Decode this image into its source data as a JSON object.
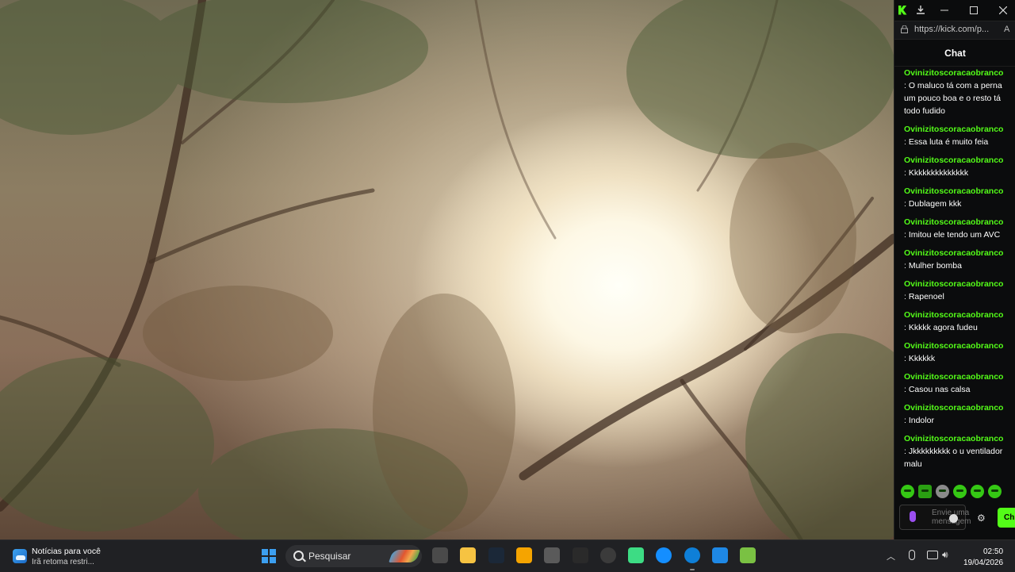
{
  "chat_window": {
    "title_icons": [
      "kick-logo-icon",
      "download-icon",
      "minimize-icon",
      "maximize-icon",
      "close-icon"
    ],
    "url": "https://kick.com/p...",
    "header": "Chat",
    "accent_color": "#53fc18",
    "messages": [
      {
        "user": "Ovinizitoscoracaobranco",
        "text": ": O maluco tá com a perna um pouco boa e o resto tá todo fudido"
      },
      {
        "user": "Ovinizitoscoracaobranco",
        "text": ": Essa luta é muito feia"
      },
      {
        "user": "Ovinizitoscoracaobranco",
        "text": ": Kkkkkkkkkkkkkk"
      },
      {
        "user": "Ovinizitoscoracaobranco",
        "text": ": Dublagem kkk"
      },
      {
        "user": "Ovinizitoscoracaobranco",
        "text": ": Imitou ele tendo um AVC"
      },
      {
        "user": "Ovinizitoscoracaobranco",
        "text": ": Mulher bomba"
      },
      {
        "user": "Ovinizitoscoracaobranco",
        "text": ": Rapenoel"
      },
      {
        "user": "Ovinizitoscoracaobranco",
        "text": ": Kkkkk agora fudeu"
      },
      {
        "user": "Ovinizitoscoracaobranco",
        "text": ": Kkkkkk"
      },
      {
        "user": "Ovinizitoscoracaobranco",
        "text": ": Casou nas calsa"
      },
      {
        "user": "Ovinizitoscoracaobranco",
        "text": ": Indolor"
      },
      {
        "user": "Ovinizitoscoracaobranco",
        "text": ": Jkkkkkkkkk o u ventilador malu"
      }
    ],
    "input": {
      "placeholder": "Envie uma mensagem"
    },
    "send_label": "Ch"
  },
  "taskbar": {
    "news": {
      "title": "Notícias para você",
      "subtitle": "Irã retoma restri..."
    },
    "search_placeholder": "Pesquisar",
    "apps": [
      "task-view",
      "file-explorer",
      "steam",
      "rockstar-launcher",
      "settings-gear",
      "epic-games",
      "obs-studio",
      "android-studio",
      "battle-net",
      "edge",
      "notepad",
      "bluestacks"
    ],
    "time": "02:50",
    "date": "19/04/2026"
  }
}
